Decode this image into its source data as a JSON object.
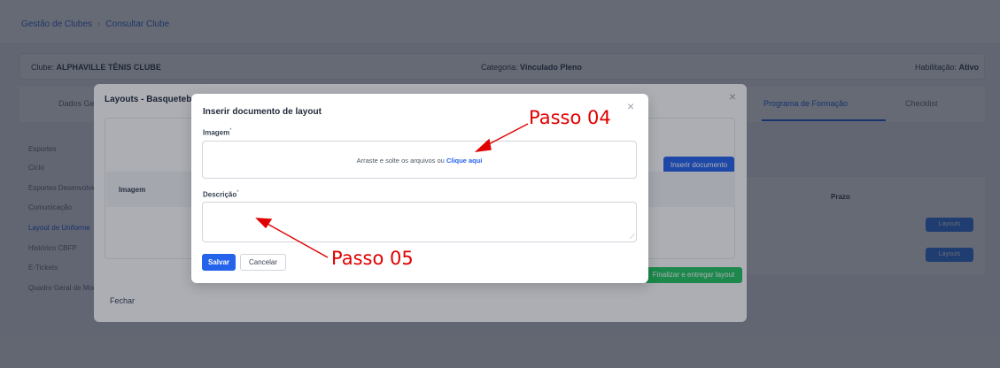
{
  "breadcrumb": {
    "root": "Gestão de Clubes",
    "current": "Consultar Clube"
  },
  "club_bar": {
    "club_label": "Clube:",
    "club_name": "ALPHAVILLE TÊNIS CLUBE",
    "category_label": "Categoria:",
    "category_value": "Vinculado Pleno",
    "status_label": "Habilitação:",
    "status_value": "Ativo"
  },
  "tabs": [
    {
      "label": "Dados Gerais",
      "active": false
    },
    {
      "label": "Programa de Formação",
      "active": true
    },
    {
      "label": "Checklist",
      "active": false
    }
  ],
  "sidenav": [
    {
      "label": "Esportes"
    },
    {
      "label": "Ciclo"
    },
    {
      "label": "Esportes Desenvolvidos"
    },
    {
      "label": "Comunicação"
    },
    {
      "label": "Layout de Uniforme",
      "active": true
    },
    {
      "label": "Histórico CBFP"
    },
    {
      "label": "E-Tickets"
    },
    {
      "label": "Quadro Geral de Modalidades"
    }
  ],
  "background_table": {
    "prazo_header": "Prazo",
    "layout_buttons": [
      "Layouts",
      "Layouts"
    ]
  },
  "layouts_modal": {
    "title": "Layouts - Basquetebol",
    "insert_button": "Inserir documento",
    "column_image": "Imagem",
    "green_button": "Finalizar e entregar layout",
    "close_button": "Fechar"
  },
  "insert_modal": {
    "title": "Inserir documento de layout",
    "image_label": "Imagem",
    "required_mark": "*",
    "dropzone_text": "Arraste e solte os arquivos ou",
    "dropzone_link": "Clique aqui",
    "description_label": "Descrição",
    "description_value": "",
    "save_button": "Salvar",
    "cancel_button": "Cancelar",
    "close_glyph": "×"
  },
  "annotations": {
    "step4": "Passo 04",
    "step5": "Passo 05",
    "color": "#e00000"
  },
  "colors": {
    "primary": "#2563eb",
    "success": "#22c55e",
    "overlay": "#111827"
  }
}
